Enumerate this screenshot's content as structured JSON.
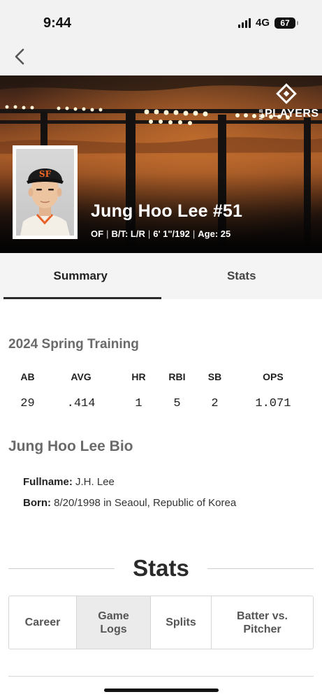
{
  "status_bar": {
    "time": "9:44",
    "network": "4G",
    "battery": "67"
  },
  "nav": {
    "back_icon": "chevron-left-icon"
  },
  "hero": {
    "logo_text": "PLAYERS",
    "logo_small": "MLB",
    "player_name": "Jung Hoo Lee #51",
    "meta": [
      "OF",
      "B/T: L/R",
      "6' 1\"/192",
      "Age: 25"
    ]
  },
  "tabs": [
    {
      "label": "Summary",
      "active": true
    },
    {
      "label": "Stats",
      "active": false
    }
  ],
  "spring_training": {
    "title": "2024 Spring Training",
    "headers": [
      "AB",
      "AVG",
      "HR",
      "RBI",
      "SB",
      "OPS"
    ],
    "values": [
      "29",
      ".414",
      "1",
      "5",
      "2",
      "1.071"
    ]
  },
  "bio": {
    "title": "Jung Hoo Lee Bio",
    "fullname_label": "Fullname:",
    "fullname_value": "J.H. Lee",
    "born_label": "Born:",
    "born_value": "8/20/1998 in Seaoul, Republic of Korea"
  },
  "stats_section": {
    "heading": "Stats",
    "subtabs": [
      {
        "label": "Career",
        "active": false
      },
      {
        "label": "Game\nLogs",
        "active": true
      },
      {
        "label": "Splits",
        "active": false
      },
      {
        "label": "Batter vs.\nPitcher",
        "active": false
      }
    ]
  },
  "colors": {
    "hero_orange": "#a75b28",
    "tab_underline": "#2a2a2a",
    "giants_orange": "#f26722"
  }
}
